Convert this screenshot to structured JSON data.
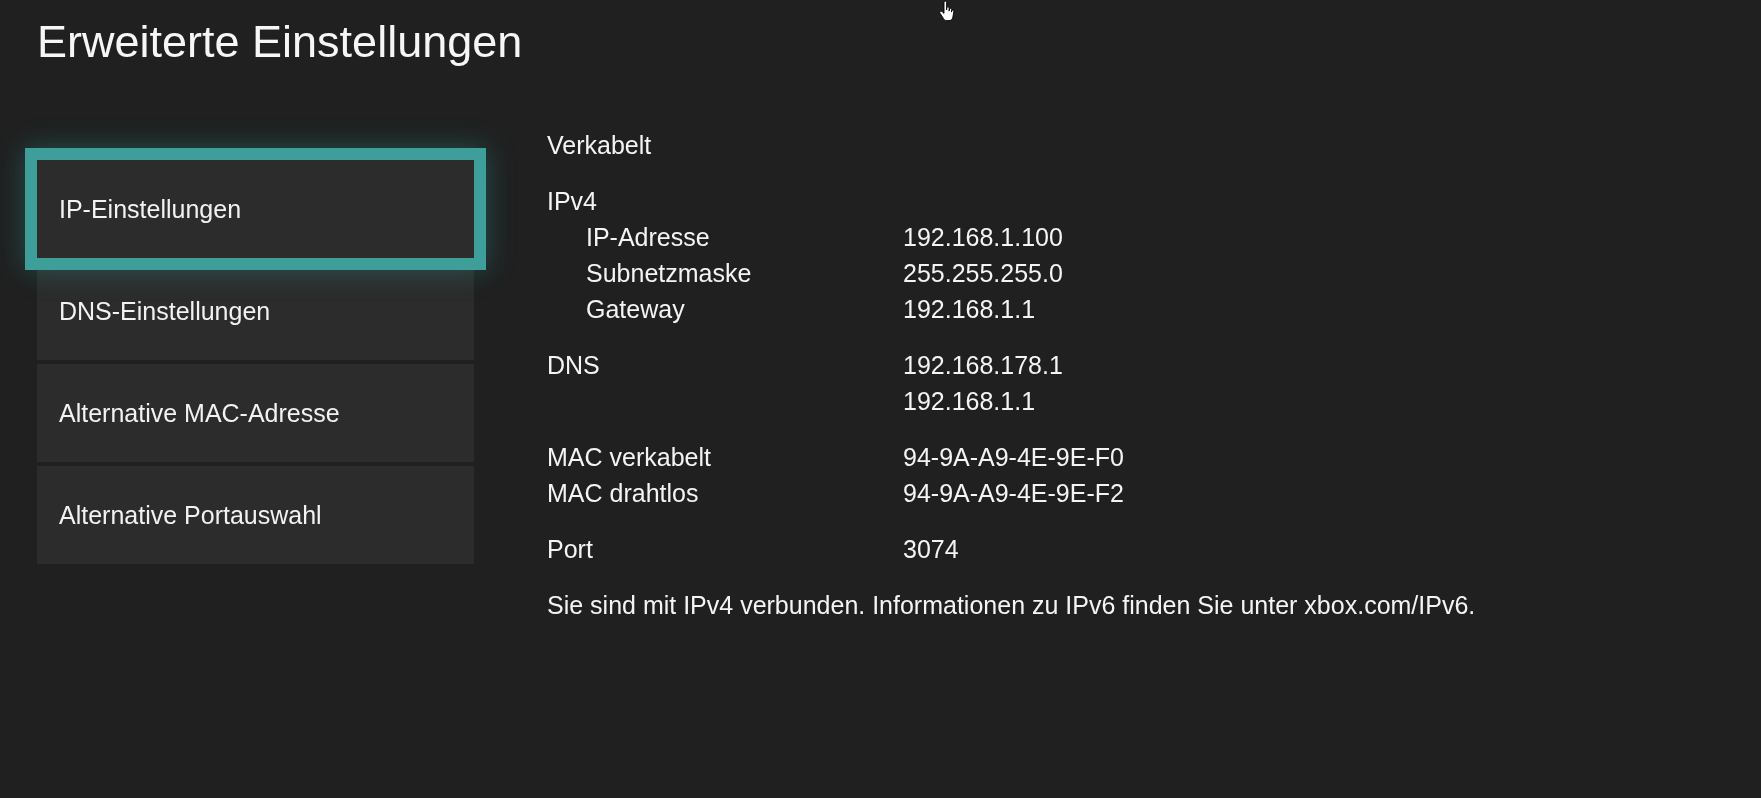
{
  "page": {
    "title": "Erweiterte Einstellungen"
  },
  "menu": {
    "items": [
      {
        "label": "IP-Einstellungen",
        "selected": true
      },
      {
        "label": "DNS-Einstellungen",
        "selected": false
      },
      {
        "label": "Alternative MAC-Adresse",
        "selected": false
      },
      {
        "label": "Alternative Portauswahl",
        "selected": false
      }
    ]
  },
  "details": {
    "connection": "Verkabelt",
    "groups": [
      {
        "kind": "section",
        "heading": "IPv4",
        "rows": [
          {
            "label": "IP-Adresse",
            "values": [
              "192.168.1.100"
            ]
          },
          {
            "label": "Subnetzmaske",
            "values": [
              "255.255.255.0"
            ]
          },
          {
            "label": "Gateway",
            "values": [
              "192.168.1.1"
            ]
          }
        ]
      },
      {
        "kind": "plain",
        "rows": [
          {
            "label": "DNS",
            "values": [
              "192.168.178.1",
              "192.168.1.1"
            ]
          }
        ]
      },
      {
        "kind": "plain",
        "rows": [
          {
            "label": "MAC verkabelt",
            "values": [
              "94-9A-A9-4E-9E-F0"
            ]
          },
          {
            "label": "MAC drahtlos",
            "values": [
              "94-9A-A9-4E-9E-F2"
            ]
          }
        ]
      },
      {
        "kind": "plain",
        "rows": [
          {
            "label": "Port",
            "values": [
              "3074"
            ]
          }
        ]
      }
    ],
    "note": "Sie sind mit IPv4 verbunden. Informationen zu IPv6 finden Sie unter xbox.com/IPv6."
  }
}
